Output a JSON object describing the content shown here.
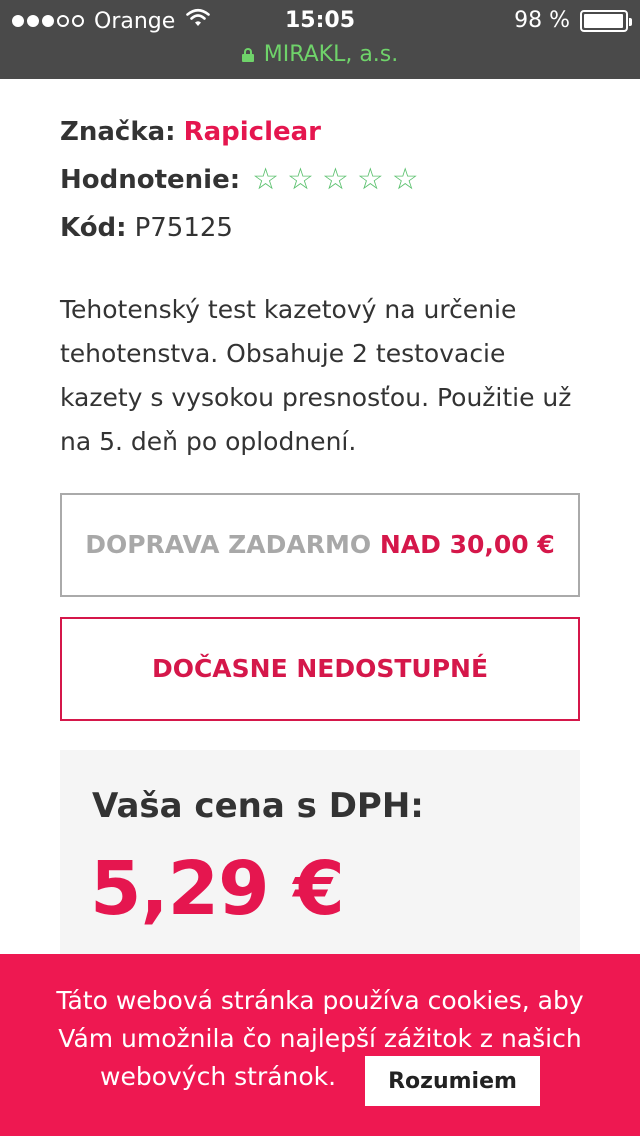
{
  "status_bar": {
    "carrier": "Orange",
    "signal_dots": [
      true,
      true,
      true,
      false,
      false
    ],
    "time": "15:05",
    "battery_text": "98 %",
    "battery_level": 0.98,
    "site": "MIRAKL, a.s."
  },
  "product": {
    "brand_label": "Značka:",
    "brand_value": "Rapiclear",
    "rating_label": "Hodnotenie:",
    "rating_stars": 5,
    "rating_filled": 0,
    "code_label": "Kód:",
    "code_value": "P75125",
    "description": "Tehotenský test kazetový na určenie tehotenstva. Obsahuje 2 testovacie kazety s vysokou presnosťou. Použitie už na 5. deň po oplodnení."
  },
  "shipping": {
    "text": "DOPRAVA ZADARMO",
    "threshold": "NAD 30,00 €"
  },
  "availability": {
    "label": "DOČASNE NEDOSTUPNÉ"
  },
  "price": {
    "label": "Vaša cena s DPH:",
    "value": "5,29 €"
  },
  "cookie_banner": {
    "line1": "Táto webová stránka používa cookies, aby",
    "line2": "Vám umožnila čo najlepší zážitok z našich",
    "line3": "webových stránok.",
    "accept_label": "Rozumiem"
  },
  "colors": {
    "accent": "#e5164f",
    "star": "#5cc16f",
    "cookie_bg": "#ee1851",
    "url_green": "#6fd36a"
  }
}
